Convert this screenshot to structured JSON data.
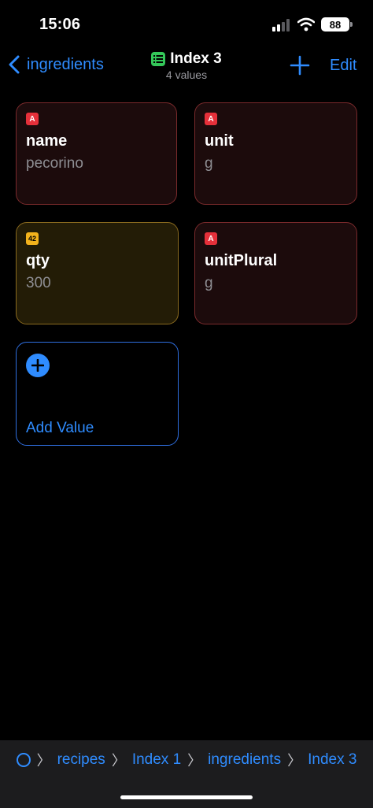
{
  "status_bar": {
    "time": "15:06",
    "battery": "88"
  },
  "nav": {
    "back_label": "ingredients",
    "title": "Index 3",
    "subtitle": "4 values",
    "edit_label": "Edit"
  },
  "cards": [
    {
      "type_badge": "A",
      "key": "name",
      "value": "pecorino"
    },
    {
      "type_badge": "A",
      "key": "unit",
      "value": "g"
    },
    {
      "type_badge": "42",
      "key": "qty",
      "value": "300"
    },
    {
      "type_badge": "A",
      "key": "unitPlural",
      "value": "g"
    }
  ],
  "add_value_label": "Add Value",
  "breadcrumb": [
    "recipes",
    "Index 1",
    "ingredients",
    "Index 3"
  ],
  "colors": {
    "accent": "#2f8cff",
    "text_type": "#e5303a",
    "number_type": "#f2b21c"
  }
}
